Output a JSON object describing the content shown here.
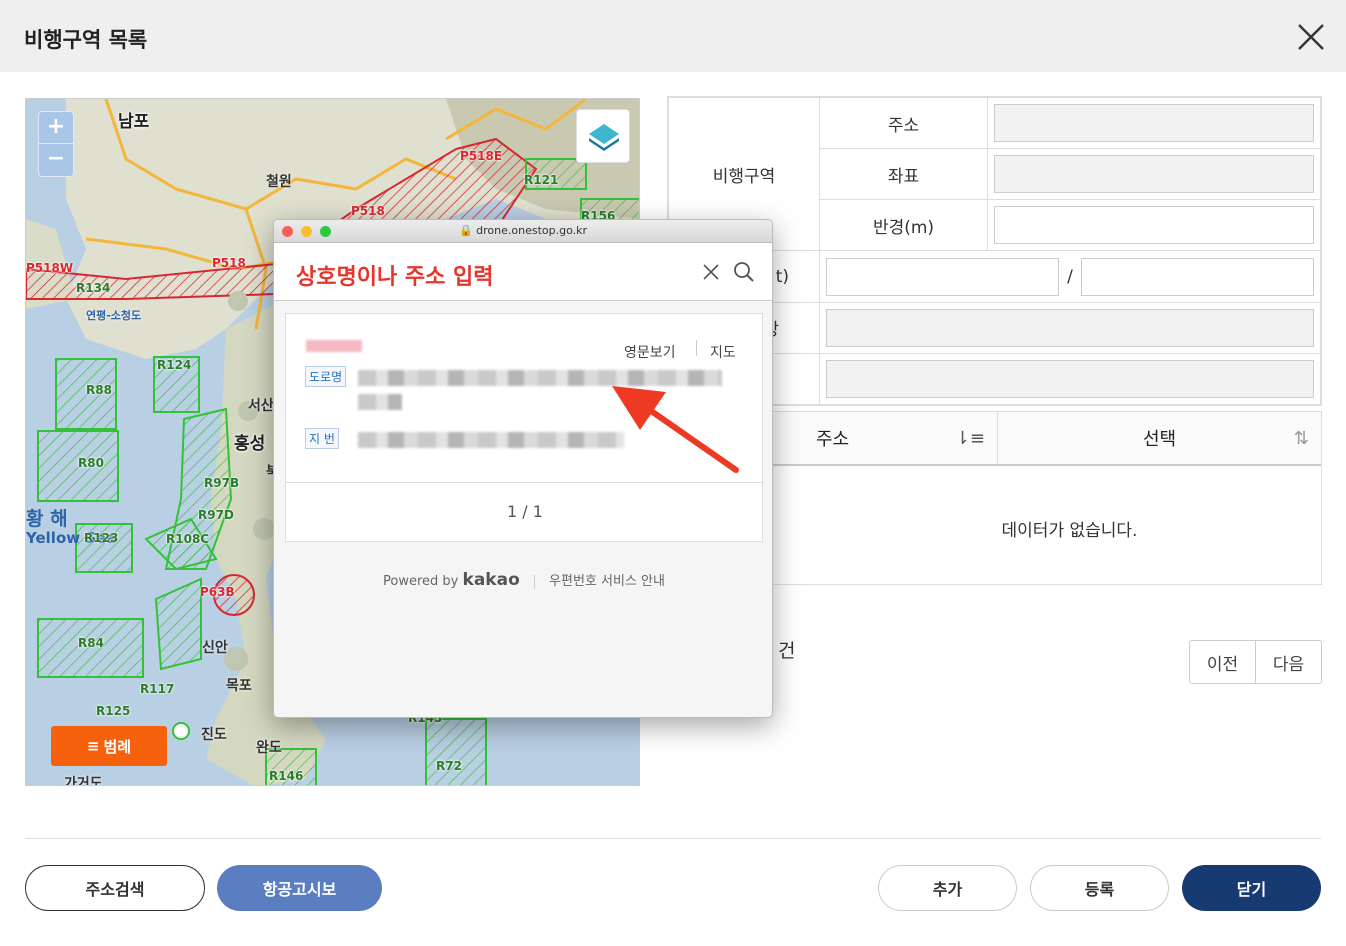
{
  "dialog": {
    "title": "비행구역 목록"
  },
  "map": {
    "zoom_in": "+",
    "zoom_out": "−",
    "legend_button": "범례",
    "cities": [
      "남포",
      "철원",
      "서산",
      "홍성",
      "신안",
      "목포",
      "진도",
      "완도",
      "가거도"
    ],
    "sea_label": "황 해",
    "sea_label_en": "Yellow Sea",
    "zones_red": [
      "P518E",
      "P518",
      "P518W",
      "P518",
      "P63B"
    ],
    "zones_green": [
      "R121",
      "R156",
      "R134",
      "R124",
      "R88",
      "R80",
      "R97B",
      "R97D",
      "R108C",
      "R123",
      "R84",
      "R117",
      "R125",
      "R146",
      "R72",
      "R143"
    ],
    "place_misc": [
      "연평-소청도",
      "북"
    ]
  },
  "form": {
    "section_label": "비행구역",
    "address_label": "주소",
    "coord_label": "좌표",
    "radius_label": "반경(m)",
    "row4_label_tail": "t)",
    "slash": "/",
    "row5_label_tail": "상"
  },
  "grid": {
    "col_address": "주소",
    "col_select": "선택",
    "empty": "데이터가 없습니다."
  },
  "count_tail": "건",
  "pager": {
    "prev": "이전",
    "next": "다음"
  },
  "buttons": {
    "address_search": "주소검색",
    "notam": "항공고시보",
    "add": "추가",
    "register": "등록",
    "close": "닫기"
  },
  "popup": {
    "url": "drone.onestop.go.kr",
    "placeholder": "상호명이나 주소 입력",
    "link_english": "영문보기",
    "link_map": "지도",
    "tag_road": "도로명",
    "tag_lot": "지 번",
    "page": "1 / 1",
    "powered": "Powered by",
    "brand": "kakao",
    "service": "우편번호 서비스 안내"
  },
  "colors": {
    "accent_orange": "#f5610c",
    "primary_blue": "#5b7ec1",
    "navy": "#173a72",
    "zone_red": "#d9262f",
    "zone_green": "#34c13a",
    "arrow": "#ee3a22"
  }
}
